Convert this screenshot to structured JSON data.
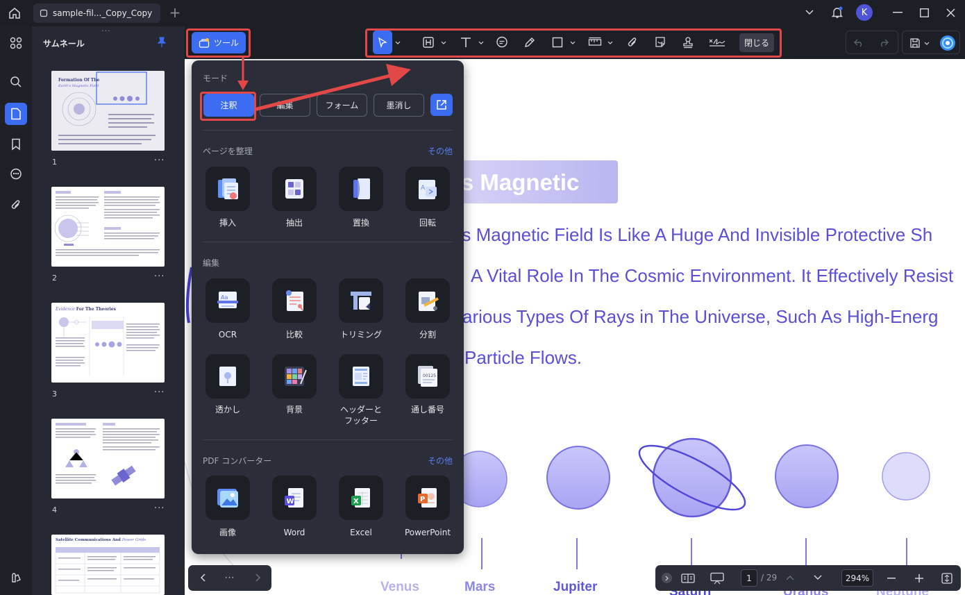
{
  "window": {
    "tab_title": "sample-fil..._Copy_Copy",
    "user_initial": "K"
  },
  "sidebar": {
    "panel_title": "サムネール",
    "pages": [
      "1",
      "2",
      "3",
      "4"
    ]
  },
  "toolbar": {
    "tools_label": "ツール",
    "close_label": "閉じる"
  },
  "tools_panel": {
    "mode_heading": "モード",
    "modes": [
      "注釈",
      "編集",
      "フォーム",
      "墨消し"
    ],
    "organize_heading": "ページを整理",
    "organize_more": "その他",
    "organize_items": [
      "挿入",
      "抽出",
      "置換",
      "回転"
    ],
    "edit_heading": "編集",
    "edit_items": [
      "OCR",
      "比較",
      "トリミング",
      "分割",
      "透かし",
      "背景",
      "ヘッダーと\nフッター",
      "通し番号"
    ],
    "convert_heading": "PDF コンバーター",
    "convert_more": "その他",
    "convert_items": [
      "画像",
      "Word",
      "Excel",
      "PowerPoint"
    ]
  },
  "document": {
    "heading": "'s Magnetic",
    "lines": [
      "h's Magnetic Field Is Like A Huge And Invisible Protective Sh",
      "A Vital Role In The Cosmic Environment. It Effectively Resist",
      "arious Types Of Rays in The Universe, Such As High-Energ",
      "Particle Flows."
    ],
    "planets": [
      "Venus",
      "Mars",
      "Jupiter",
      "Saturn",
      "Uranus",
      "Neptune"
    ]
  },
  "thumbnails": {
    "p1_title_a": "Formation Of The",
    "p1_title_b": "Earth's Magnetic Field",
    "p3_title_a": "Evidence",
    "p3_title_b": "For The Theories",
    "p5_title_a": "Satellite Communications And",
    "p5_title_b": "Power Grids"
  },
  "statusbar": {
    "page_current": "1",
    "page_total": "/ 29",
    "zoom": "294%"
  },
  "colors": {
    "accent": "#3b6cf2",
    "highlight_red": "#e24848",
    "doc_text": "#5a4fd6",
    "panel_bg": "#2b2e38"
  }
}
